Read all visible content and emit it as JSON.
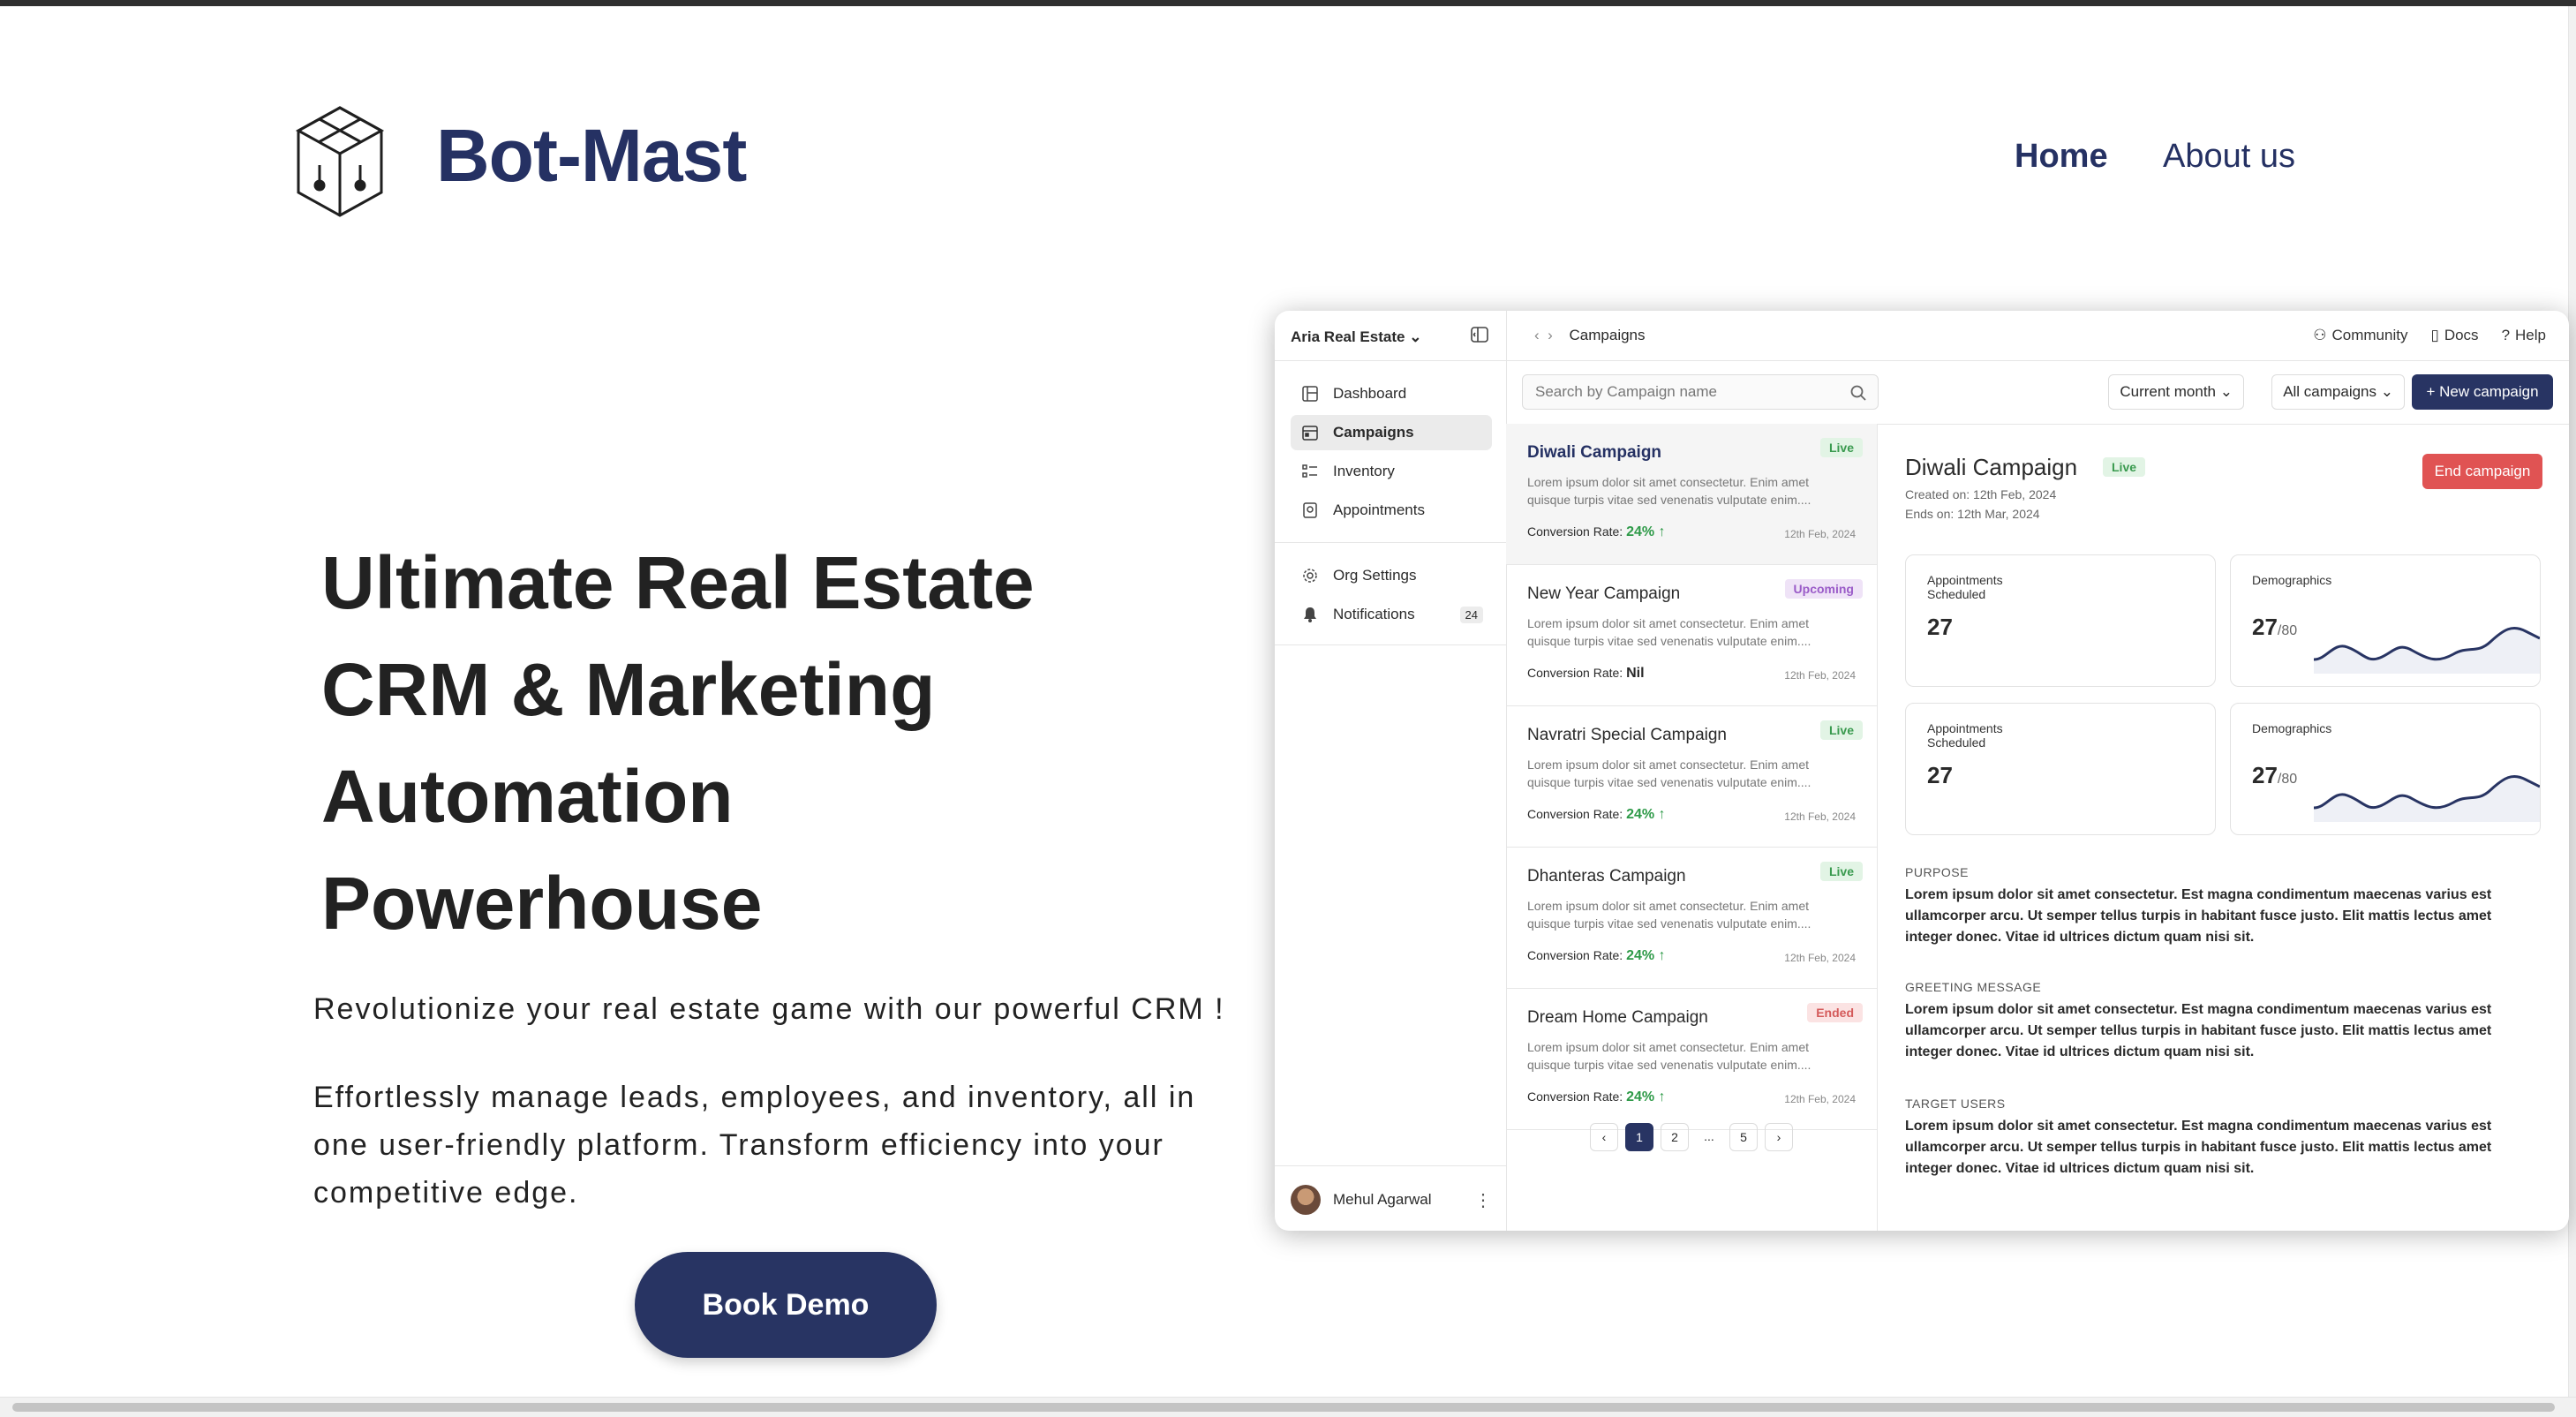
{
  "header": {
    "brand": "Bot-Mast",
    "nav": {
      "home": "Home",
      "about": "About us"
    }
  },
  "hero": {
    "title_lines": [
      "Ultimate Real Estate",
      "CRM & Marketing",
      "Automation",
      "Powerhouse"
    ],
    "subtitle": "Revolutionize your real estate game with our powerful CRM !",
    "description": "Effortlessly manage leads, employees, and inventory, all in one user-friendly platform. Transform efficiency into your competitive edge.",
    "cta": "Book Demo"
  },
  "app": {
    "org": "Aria Real Estate",
    "sidebar": {
      "items": [
        {
          "label": "Dashboard",
          "icon": "dashboard-icon"
        },
        {
          "label": "Campaigns",
          "icon": "calendar-icon"
        },
        {
          "label": "Inventory",
          "icon": "list-icon"
        },
        {
          "label": "Appointments",
          "icon": "appointment-icon"
        }
      ],
      "secondary": [
        {
          "label": "Org Settings",
          "icon": "gear-icon"
        },
        {
          "label": "Notifications",
          "icon": "bell-icon",
          "badge": "24"
        }
      ],
      "user": "Mehul Agarwal"
    },
    "breadcrumb": "Campaigns",
    "toplinks": {
      "community": "Community",
      "docs": "Docs",
      "help": "Help"
    },
    "toolbar": {
      "search_placeholder": "Search by Campaign name",
      "period": "Current month",
      "filter": "All campaigns",
      "new_label": "+ New campaign"
    },
    "campaigns": [
      {
        "title": "Diwali Campaign",
        "status": "Live",
        "desc": "Lorem ipsum dolor sit amet consectetur. Enim amet quisque turpis vitae sed venenatis vulputate enim....",
        "rate_label": "Conversion Rate:",
        "rate": "24% ↑",
        "date": "12th Feb, 2024"
      },
      {
        "title": "New Year Campaign",
        "status": "Upcoming",
        "desc": "Lorem ipsum dolor sit amet consectetur. Enim amet quisque turpis vitae sed venenatis vulputate enim....",
        "rate_label": "Conversion Rate:",
        "rate": "Nil",
        "date": "12th Feb, 2024"
      },
      {
        "title": "Navratri Special Campaign",
        "status": "Live",
        "desc": "Lorem ipsum dolor sit amet consectetur. Enim amet quisque turpis vitae sed venenatis vulputate enim....",
        "rate_label": "Conversion Rate:",
        "rate": "24% ↑",
        "date": "12th Feb, 2024"
      },
      {
        "title": "Dhanteras Campaign",
        "status": "Live",
        "desc": "Lorem ipsum dolor sit amet consectetur. Enim amet quisque turpis vitae sed venenatis vulputate enim....",
        "rate_label": "Conversion Rate:",
        "rate": "24% ↑",
        "date": "12th Feb, 2024"
      },
      {
        "title": "Dream Home Campaign",
        "status": "Ended",
        "desc": "Lorem ipsum dolor sit amet consectetur. Enim amet quisque turpis vitae sed venenatis vulputate enim....",
        "rate_label": "Conversion Rate:",
        "rate": "24% ↑",
        "date": "12th Feb, 2024"
      }
    ],
    "pagination": {
      "prev": "‹",
      "pages": [
        "1",
        "2",
        "...",
        "5"
      ],
      "next": "›",
      "current": "1"
    },
    "detail": {
      "title": "Diwali Campaign",
      "status": "Live",
      "created": "Created on: 12th Feb, 2024",
      "ends": "Ends on: 12th Mar, 2024",
      "end_button": "End campaign",
      "stats": [
        {
          "label": "Appointments Scheduled",
          "value": "27",
          "suffix": ""
        },
        {
          "label": "Demographics",
          "value": "27",
          "suffix": "/80"
        },
        {
          "label": "Appointments Scheduled",
          "value": "27",
          "suffix": ""
        },
        {
          "label": "Demographics",
          "value": "27",
          "suffix": "/80"
        }
      ],
      "sections": [
        {
          "heading": "PURPOSE",
          "text": "Lorem ipsum dolor sit amet consectetur. Est magna condimentum maecenas varius est ullamcorper arcu. Ut semper tellus turpis in habitant fusce justo. Elit mattis lectus amet integer donec. Vitae id ultrices dictum quam nisi sit."
        },
        {
          "heading": "GREETING MESSAGE",
          "text": "Lorem ipsum dolor sit amet consectetur. Est magna condimentum maecenas varius est ullamcorper arcu. Ut semper tellus turpis in habitant fusce justo. Elit mattis lectus amet integer donec. Vitae id ultrices dictum quam nisi sit."
        },
        {
          "heading": "TARGET USERS",
          "text": "Lorem ipsum dolor sit amet consectetur. Est magna condimentum maecenas varius est ullamcorper arcu. Ut semper tellus turpis in habitant fusce justo. Elit mattis lectus amet integer donec. Vitae id ultrices dictum quam nisi sit."
        }
      ]
    }
  },
  "colors": {
    "brand": "#253163",
    "live": "#3a9a4f",
    "upcoming": "#9a5bc8",
    "ended": "#d45a5a",
    "danger": "#e05353"
  }
}
